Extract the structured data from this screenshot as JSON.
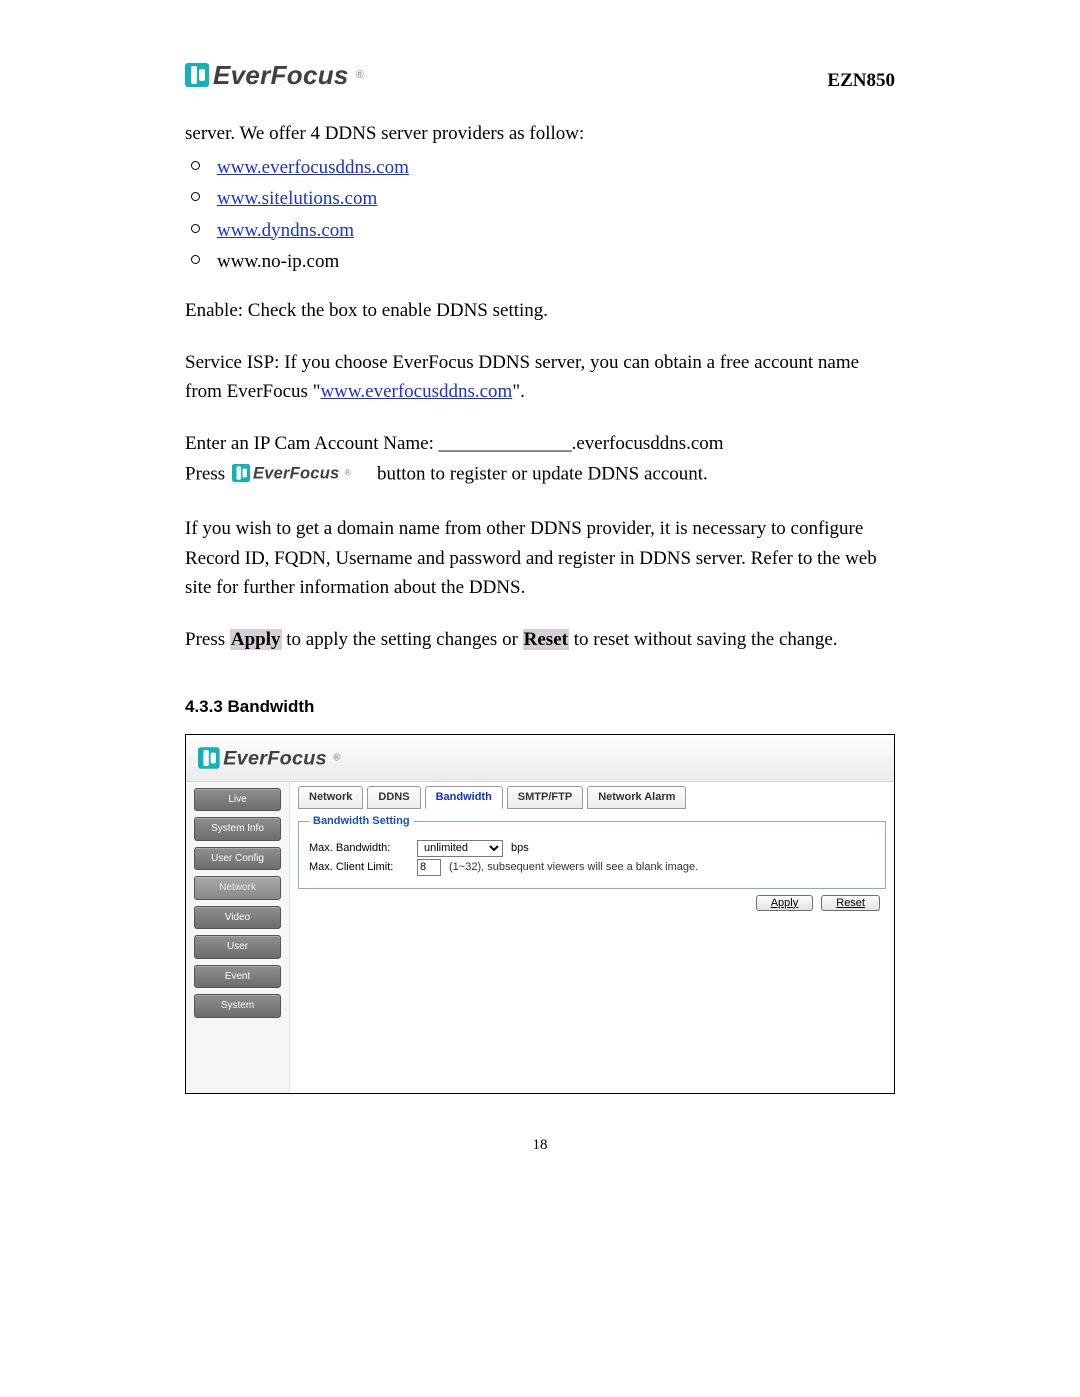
{
  "header": {
    "brand": "EverFocus",
    "model": "EZN850"
  },
  "intro": "server. We offer 4 DDNS server providers as follow:",
  "ddns_links": [
    {
      "text": "www.everfocusddns.com",
      "link": true
    },
    {
      "text": "www.sitelutions.com",
      "link": true
    },
    {
      "text": "www.dyndns.com",
      "link": true
    },
    {
      "text": "www.no-ip.com",
      "link": false
    }
  ],
  "enable_line": "Enable: Check the box to enable DDNS setting.",
  "service_isp_pre": "Service ISP: If you choose EverFocus DDNS server, you can obtain a free account name from EverFocus \"",
  "service_isp_link": "www.everfocusddns.com",
  "service_isp_post": "\".",
  "entry": {
    "label": "Enter an IP Cam Account Name:  ______________.everfocusddns.com",
    "press": "Press ",
    "press_tail": " button to register or update DDNS account."
  },
  "other_provider": "If you wish to get a domain name from other DDNS provider, it is necessary to configure Record ID, FQDN, Username and password and register in DDNS server. Refer to the web site for further information about the DDNS.",
  "apply_reset": {
    "pre": "Press ",
    "apply": "Apply",
    "mid": " to apply the setting changes or ",
    "reset": "Reset",
    "post": " to reset without saving the change."
  },
  "section_title": "4.3.3 Bandwidth",
  "ui": {
    "brand": "EverFocus",
    "side": [
      "Live",
      "System Info",
      "User Config",
      "Network",
      "Video",
      "User",
      "Event",
      "System"
    ],
    "side_active_index": 3,
    "tabs": [
      "Network",
      "DDNS",
      "Bandwidth",
      "SMTP/FTP",
      "Network Alarm"
    ],
    "tab_selected_index": 2,
    "group_title": "Bandwidth Setting",
    "rows": {
      "bw_label": "Max. Bandwidth:",
      "bw_value": "unlimited",
      "bw_unit": "bps",
      "cl_label": "Max. Client Limit:",
      "cl_value": "8",
      "cl_hint": "(1~32), subsequent viewers will see a blank image."
    },
    "buttons": {
      "apply": "Apply",
      "reset": "Reset"
    }
  },
  "page_number": "18"
}
